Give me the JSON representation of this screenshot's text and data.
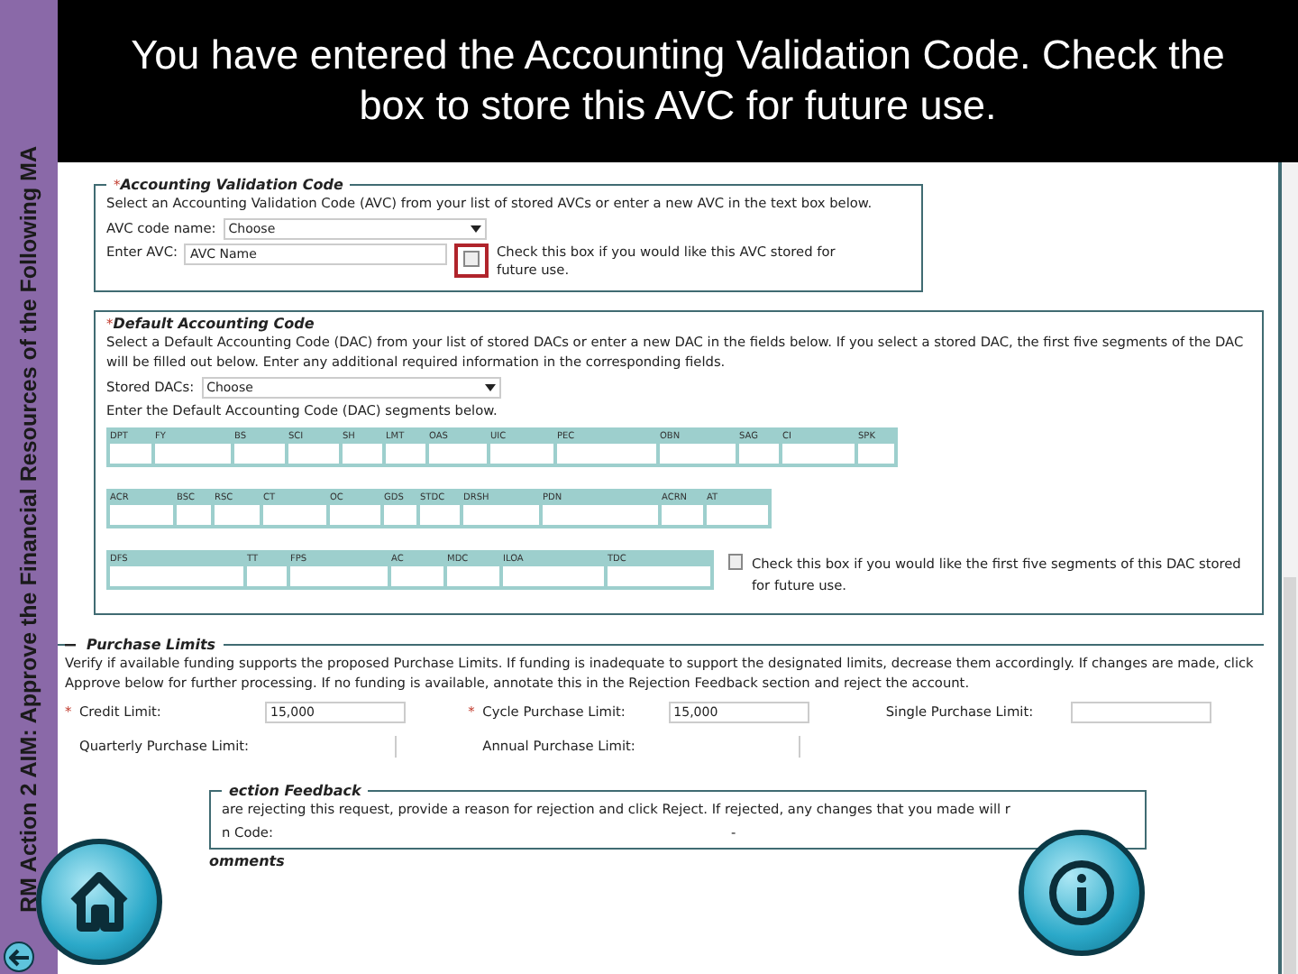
{
  "sidebar": {
    "title": "RM  Action 2  AIM: Approve the Financial Resources of the Following MA"
  },
  "banner": {
    "text": "You have entered the Accounting Validation Code.  Check the box to store this AVC for future use."
  },
  "avc": {
    "required_mark": "*",
    "title": "Accounting Validation Code",
    "intro": "Select an Accounting Validation Code (AVC) from your list of stored AVCs or enter a new AVC in the text box below.",
    "code_name_label": "AVC code name:",
    "code_name_value": "Choose",
    "enter_label": "Enter AVC:",
    "enter_value": "AVC Name",
    "checkbox": {
      "checked": false,
      "highlighted": true,
      "label": "Check this box if you would like this AVC stored for future use."
    }
  },
  "dac": {
    "required_mark": "*",
    "title": "Default Accounting Code",
    "intro": "Select a Default Accounting Code (DAC) from your list of stored DACs or enter a new DAC in the fields below. If you select a stored DAC, the first five segments of the DAC will be filled out below. Enter any additional required information in the corresponding fields.",
    "stored_label": "Stored DACs:",
    "stored_value": "Choose",
    "segments_label": "Enter the Default Accounting Code (DAC) segments below.",
    "segment_rows": [
      [
        "DPT",
        "FY",
        "BS",
        "SCI",
        "SH",
        "LMT",
        "OAS",
        "UIC",
        "PEC",
        "OBN",
        "SAG",
        "CI",
        "SPK"
      ],
      [
        "ACR",
        "BSC",
        "RSC",
        "CT",
        "OC",
        "GDS",
        "STDC",
        "DRSH",
        "PDN",
        "ACRN",
        "AT"
      ],
      [
        "DFS",
        "TT",
        "FPS",
        "AC",
        "MDC",
        "ILOA",
        "TDC"
      ]
    ],
    "checkbox": {
      "checked": false,
      "label": "Check this box if you would like the first five segments of this DAC stored for future use."
    }
  },
  "limits": {
    "title": "Purchase Limits",
    "intro": "Verify if available funding supports the proposed Purchase Limits. If funding is inadequate to support the designated limits, decrease them accordingly. If changes are made, click Approve below for further processing. If no funding is available, annotate this in the Rejection Feedback section and reject the account.",
    "fields": [
      {
        "label": "Credit Limit:",
        "required_mark": "*",
        "value": "15,000",
        "kind": "input"
      },
      {
        "label": "Cycle Purchase Limit:",
        "required_mark": "*",
        "value": "15,000",
        "kind": "input"
      },
      {
        "label": "Single Purchase Limit:",
        "kind": "input"
      },
      {
        "label": "Quarterly Purchase Limit:",
        "kind": "readonly"
      },
      {
        "label": "Annual Purchase Limit:",
        "kind": "readonly"
      }
    ]
  },
  "rejection": {
    "title": "ection Feedback",
    "text": "are rejecting this request, provide a reason for rejection and click Reject. If rejected, any changes that you made will r",
    "code_label": "n Code:",
    "code_value": "-"
  },
  "comments": {
    "title": "omments"
  }
}
